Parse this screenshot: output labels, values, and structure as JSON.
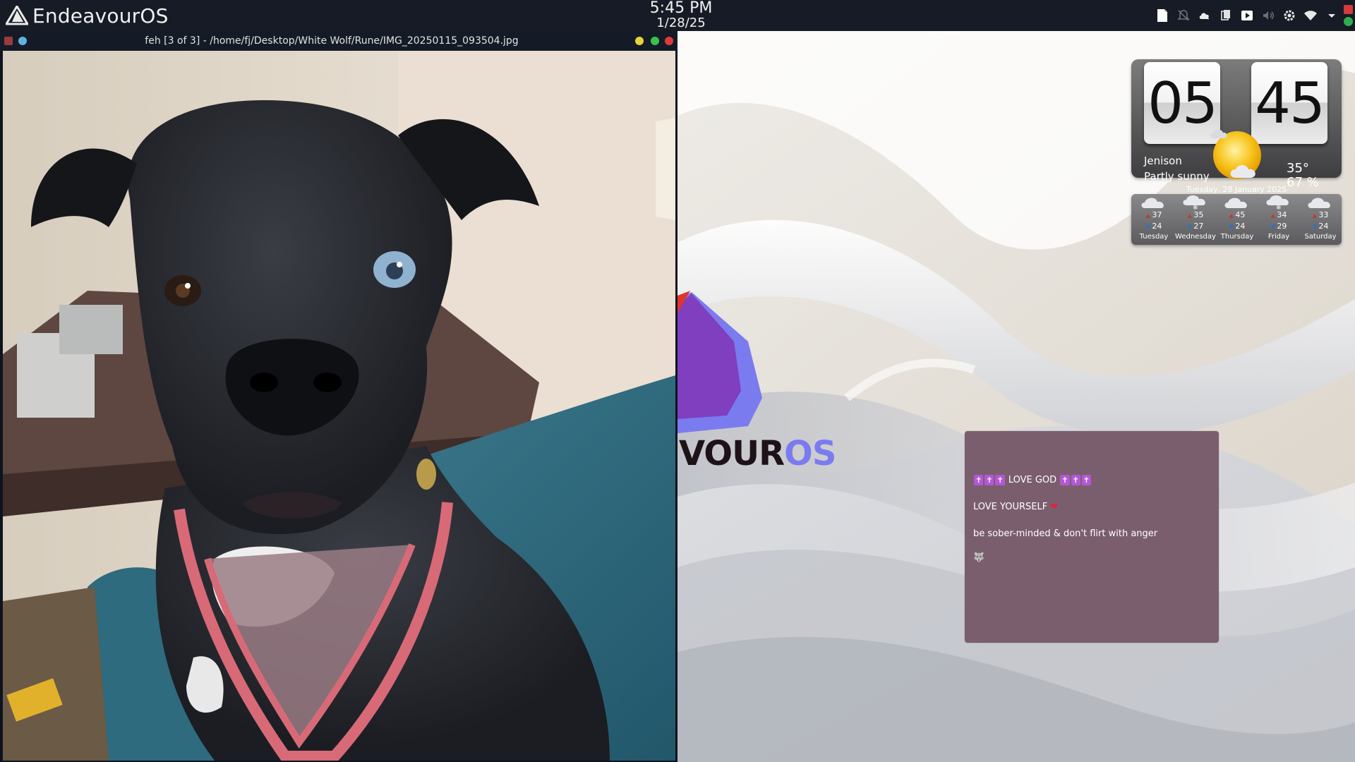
{
  "panel": {
    "app_menu_label": "EndeavourOS",
    "clock_time": "5:45 PM",
    "clock_date": "1/28/25",
    "tray_icons": [
      "document-icon",
      "notification-icon",
      "cloud-icon",
      "clipboard-icon",
      "media-play-icon",
      "volume-icon",
      "settings-icon",
      "wifi-icon",
      "chevron-down-icon",
      "lock-icon",
      "update-icon"
    ]
  },
  "feh": {
    "title": "feh [3 of 3] - /home/fj/Desktop/White Wolf/Rune/IMG_20250115_093504.jpg",
    "image_subject": "black dog with pink harness"
  },
  "weather_widget": {
    "hours": "05",
    "minutes": "45",
    "location": "Jenison",
    "condition": "Partly sunny",
    "temperature": "35°",
    "humidity": "67 %",
    "date": "Tuesday, 28 January 2025",
    "forecast": [
      {
        "day": "Tuesday",
        "high": "37",
        "low": "24",
        "icon": "cloud-icon"
      },
      {
        "day": "Wednesday",
        "high": "35",
        "low": "27",
        "icon": "snow-icon"
      },
      {
        "day": "Thursday",
        "high": "45",
        "low": "24",
        "icon": "cloud-icon"
      },
      {
        "day": "Friday",
        "high": "34",
        "low": "29",
        "icon": "snow-icon"
      },
      {
        "day": "Saturday",
        "high": "33",
        "low": "24",
        "icon": "cloud-icon"
      }
    ]
  },
  "sticky_note": {
    "line1_text": "LOVE GOD",
    "line2_text": "LOVE YOURSELF",
    "line3_text": "be sober-minded & don't flirt with anger",
    "line4_emoji": "🐺"
  },
  "logo": {
    "text_dark": "VOUR",
    "text_blue": "OS"
  },
  "colors": {
    "panel_bg": "#161b25",
    "note_bg": "#7b5e6e",
    "accent_blue": "#7b7bf0",
    "accent_purple": "#7f3fbf"
  }
}
